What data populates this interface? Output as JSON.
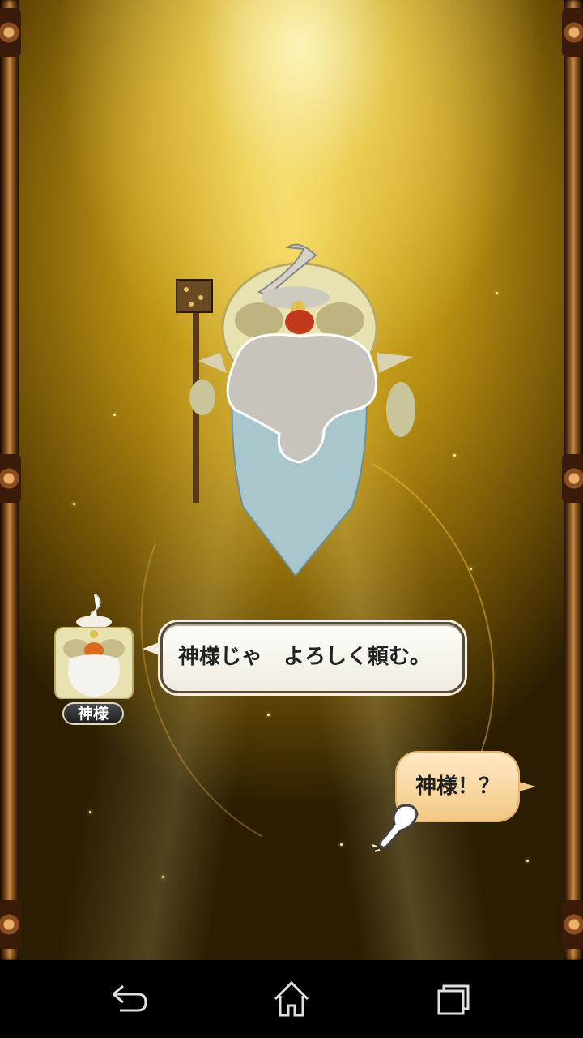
{
  "dialogue": {
    "speaker_name": "神様",
    "text": "神様じゃ　よろしく頼む。"
  },
  "reply": {
    "text": "神様！？"
  },
  "navigation": {
    "back_icon": "back-icon",
    "home_icon": "home-icon",
    "recents_icon": "recents-icon"
  },
  "colors": {
    "background_gold": "#d4ac2a",
    "frame_bronze": "#7a4a1c",
    "bubble_fill": "#fffdf8",
    "reply_fill": "#f7d59a"
  }
}
